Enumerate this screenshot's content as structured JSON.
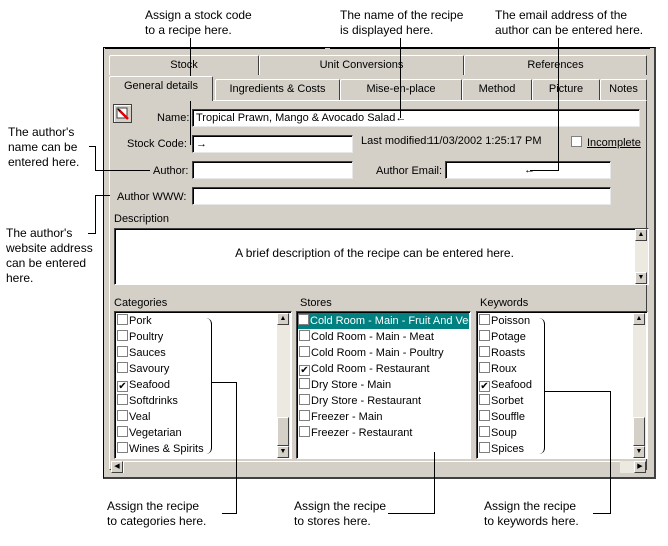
{
  "callouts": {
    "stock_code": "Assign a stock code\nto a recipe here.",
    "recipe_name": "The name of the recipe\nis displayed here.",
    "author_email": "The email address of the\nauthor can be entered here.",
    "author_name": "The author's\nname can be\nentered here.",
    "author_www": "The author's\nwebsite address\ncan be entered\nhere.",
    "categories": "Assign the recipe\nto categories here.",
    "stores": "Assign the recipe\nto stores here.",
    "keywords": "Assign the recipe\nto keywords here."
  },
  "tabs": {
    "row_back": [
      "Stock",
      "Unit Conversions",
      "References"
    ],
    "row_front": [
      "General details",
      "Ingredients & Costs",
      "Mise-en-place",
      "Method",
      "Picture",
      "Notes"
    ],
    "active": "General details"
  },
  "form": {
    "name_label": "Name:",
    "name_value": "Tropical Prawn, Mango & Avocado Salad",
    "stock_code_label": "Stock Code:",
    "stock_code_value": "",
    "last_modified_label": "Last modified:",
    "last_modified_value": "11/03/2002 1:25:17 PM",
    "incomplete_label": "Incomplete",
    "incomplete_checked": false,
    "author_label": "Author:",
    "author_value": "",
    "author_email_label": "Author Email:",
    "author_email_value": "",
    "author_www_label": "Author WWW:",
    "author_www_value": "",
    "description_label": "Description",
    "description_value": "A brief description of the recipe can be entered here."
  },
  "categories": {
    "label": "Categories",
    "items": [
      {
        "text": "Pork",
        "checked": false
      },
      {
        "text": "Poultry",
        "checked": false
      },
      {
        "text": "Sauces",
        "checked": false
      },
      {
        "text": "Savoury",
        "checked": false
      },
      {
        "text": "Seafood",
        "checked": true
      },
      {
        "text": "Softdrinks",
        "checked": false
      },
      {
        "text": "Veal",
        "checked": false
      },
      {
        "text": "Vegetarian",
        "checked": false
      },
      {
        "text": "Wines & Spirits",
        "checked": false
      }
    ]
  },
  "stores": {
    "label": "Stores",
    "items": [
      {
        "text": "Cold Room - Main - Fruit And Veg",
        "checked": false,
        "selected": true
      },
      {
        "text": "Cold Room - Main - Meat",
        "checked": false
      },
      {
        "text": "Cold Room - Main - Poultry",
        "checked": false
      },
      {
        "text": "Cold Room - Restaurant",
        "checked": true
      },
      {
        "text": "Dry Store - Main",
        "checked": false
      },
      {
        "text": "Dry Store - Restaurant",
        "checked": false
      },
      {
        "text": "Freezer - Main",
        "checked": false
      },
      {
        "text": "Freezer - Restaurant",
        "checked": false
      }
    ]
  },
  "keywords": {
    "label": "Keywords",
    "items": [
      {
        "text": "Poisson",
        "checked": false
      },
      {
        "text": "Potage",
        "checked": false
      },
      {
        "text": "Roasts",
        "checked": false
      },
      {
        "text": "Roux",
        "checked": false
      },
      {
        "text": "Seafood",
        "checked": true
      },
      {
        "text": "Sorbet",
        "checked": false
      },
      {
        "text": "Souffle",
        "checked": false
      },
      {
        "text": "Soup",
        "checked": false
      },
      {
        "text": "Spices",
        "checked": false
      }
    ]
  },
  "icons": {
    "check": "✔",
    "up": "▲",
    "down": "▼",
    "left": "◀",
    "right": "▶",
    "arrow_right": "→",
    "arrow_left": "←"
  }
}
